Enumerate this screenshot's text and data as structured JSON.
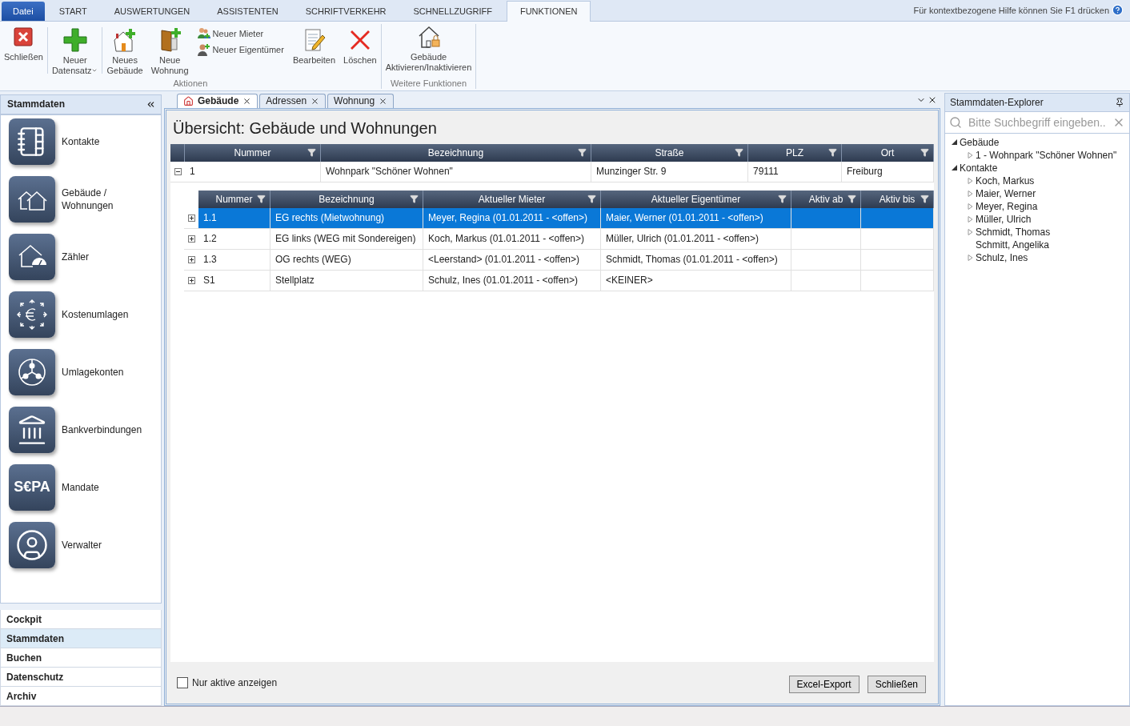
{
  "menu_tabs": [
    {
      "label": "Datei",
      "kind": "file",
      "selected": false
    },
    {
      "label": "START",
      "kind": "tab",
      "selected": false
    },
    {
      "label": "AUSWERTUNGEN",
      "kind": "tab",
      "selected": false
    },
    {
      "label": "ASSISTENTEN",
      "kind": "tab",
      "selected": false
    },
    {
      "label": "SCHRIFTVERKEHR",
      "kind": "tab",
      "selected": false
    },
    {
      "label": "SCHNELLZUGRIFF",
      "kind": "tab",
      "selected": false
    },
    {
      "label": "FUNKTIONEN",
      "kind": "tab",
      "selected": true
    }
  ],
  "help_text": "Für kontextbezogene Hilfe können Sie F1 drücken",
  "ribbon": [
    {
      "label": "Aktionen",
      "sections": [
        [
          {
            "kind": "large",
            "label": "Schließen"
          }
        ],
        [
          {
            "kind": "large",
            "label": "Neuer Datensatz",
            "dropdown": true
          }
        ],
        [
          {
            "kind": "large",
            "label": "Neues Gebäude"
          },
          {
            "kind": "large",
            "label": "Neue Wohnung"
          },
          {
            "kind": "stack",
            "items": [
              "Neuer Mieter",
              "Neuer Eigentümer"
            ]
          },
          {
            "kind": "large",
            "label": "Bearbeiten"
          },
          {
            "kind": "large",
            "label": "Löschen"
          }
        ]
      ]
    },
    {
      "label": "Weitere Funktionen",
      "sections": [
        [
          {
            "kind": "large",
            "label": "Gebäude Aktivieren/Inaktivieren"
          }
        ]
      ]
    }
  ],
  "sidebar": {
    "title": "Stammdaten",
    "items": [
      {
        "label": "Kontakte"
      },
      {
        "label": "Gebäude / Wohnungen"
      },
      {
        "label": "Zähler"
      },
      {
        "label": "Kostenumlagen"
      },
      {
        "label": "Umlagekonten"
      },
      {
        "label": "Bankverbindungen"
      },
      {
        "label": "Mandate",
        "tile_text": "S€PA"
      },
      {
        "label": "Verwalter"
      }
    ],
    "nav": [
      {
        "label": "Cockpit",
        "selected": false
      },
      {
        "label": "Stammdaten",
        "selected": true
      },
      {
        "label": "Buchen",
        "selected": false
      },
      {
        "label": "Datenschutz",
        "selected": false
      },
      {
        "label": "Archiv",
        "selected": false
      }
    ]
  },
  "doc_tabs": [
    {
      "label": "Gebäude",
      "selected": true
    },
    {
      "label": "Adressen",
      "selected": false
    },
    {
      "label": "Wohnung",
      "selected": false
    }
  ],
  "overview": {
    "title": "Übersicht: Gebäude und Wohnungen",
    "master_columns": [
      "Nummer",
      "Bezeichnung",
      "Straße",
      "PLZ",
      "Ort"
    ],
    "master_rows": [
      {
        "expanded": true,
        "cells": [
          "1",
          "Wohnpark \"Schöner Wohnen\"",
          "Munzinger Str. 9",
          "79111",
          "Freiburg"
        ]
      }
    ],
    "detail_columns": [
      "Nummer",
      "Bezeichnung",
      "Aktueller Mieter",
      "Aktueller Eigentümer",
      "Aktiv ab",
      "Aktiv bis"
    ],
    "detail_rows": [
      {
        "selected": true,
        "expanded": false,
        "cells": [
          "1.1",
          "EG rechts (Mietwohnung)",
          "Meyer, Regina (01.01.2011 - <offen>)",
          "Maier, Werner (01.01.2011 - <offen>)"
        ]
      },
      {
        "selected": false,
        "expanded": false,
        "cells": [
          "1.2",
          "EG links (WEG mit Sondereigen)",
          "Koch, Markus (01.01.2011 - <offen>)",
          "Müller, Ulrich (01.01.2011 - <offen>)"
        ]
      },
      {
        "selected": false,
        "expanded": false,
        "cells": [
          "1.3",
          "OG rechts (WEG)",
          "<Leerstand> (01.01.2011 - <offen>)",
          "Schmidt, Thomas (01.01.2011 - <offen>)"
        ]
      },
      {
        "selected": false,
        "expanded": false,
        "cells": [
          "S1",
          "Stellplatz",
          "Schulz, Ines (01.01.2011 - <offen>)",
          "<KEINER>"
        ]
      }
    ],
    "only_active": {
      "label": "Nur aktive anzeigen",
      "checked": false
    },
    "buttons": [
      "Excel-Export",
      "Schließen"
    ]
  },
  "explorer": {
    "title": "Stammdaten-Explorer",
    "search_placeholder": "Bitte Suchbegriff eingeben..",
    "tree": [
      {
        "label": "Gebäude",
        "expanded": true,
        "children": [
          {
            "label": "1 - Wohnpark \"Schöner Wohnen\"",
            "expandable": true
          }
        ]
      },
      {
        "label": "Kontakte",
        "expanded": true,
        "children": [
          {
            "label": "Koch, Markus",
            "expandable": true
          },
          {
            "label": "Maier, Werner",
            "expandable": true
          },
          {
            "label": "Meyer, Regina",
            "expandable": true
          },
          {
            "label": "Müller, Ulrich",
            "expandable": true
          },
          {
            "label": "Schmidt, Thomas",
            "expandable": true
          },
          {
            "label": "Schmitt, Angelika",
            "expandable": false
          },
          {
            "label": "Schulz, Ines",
            "expandable": true
          }
        ]
      }
    ]
  }
}
